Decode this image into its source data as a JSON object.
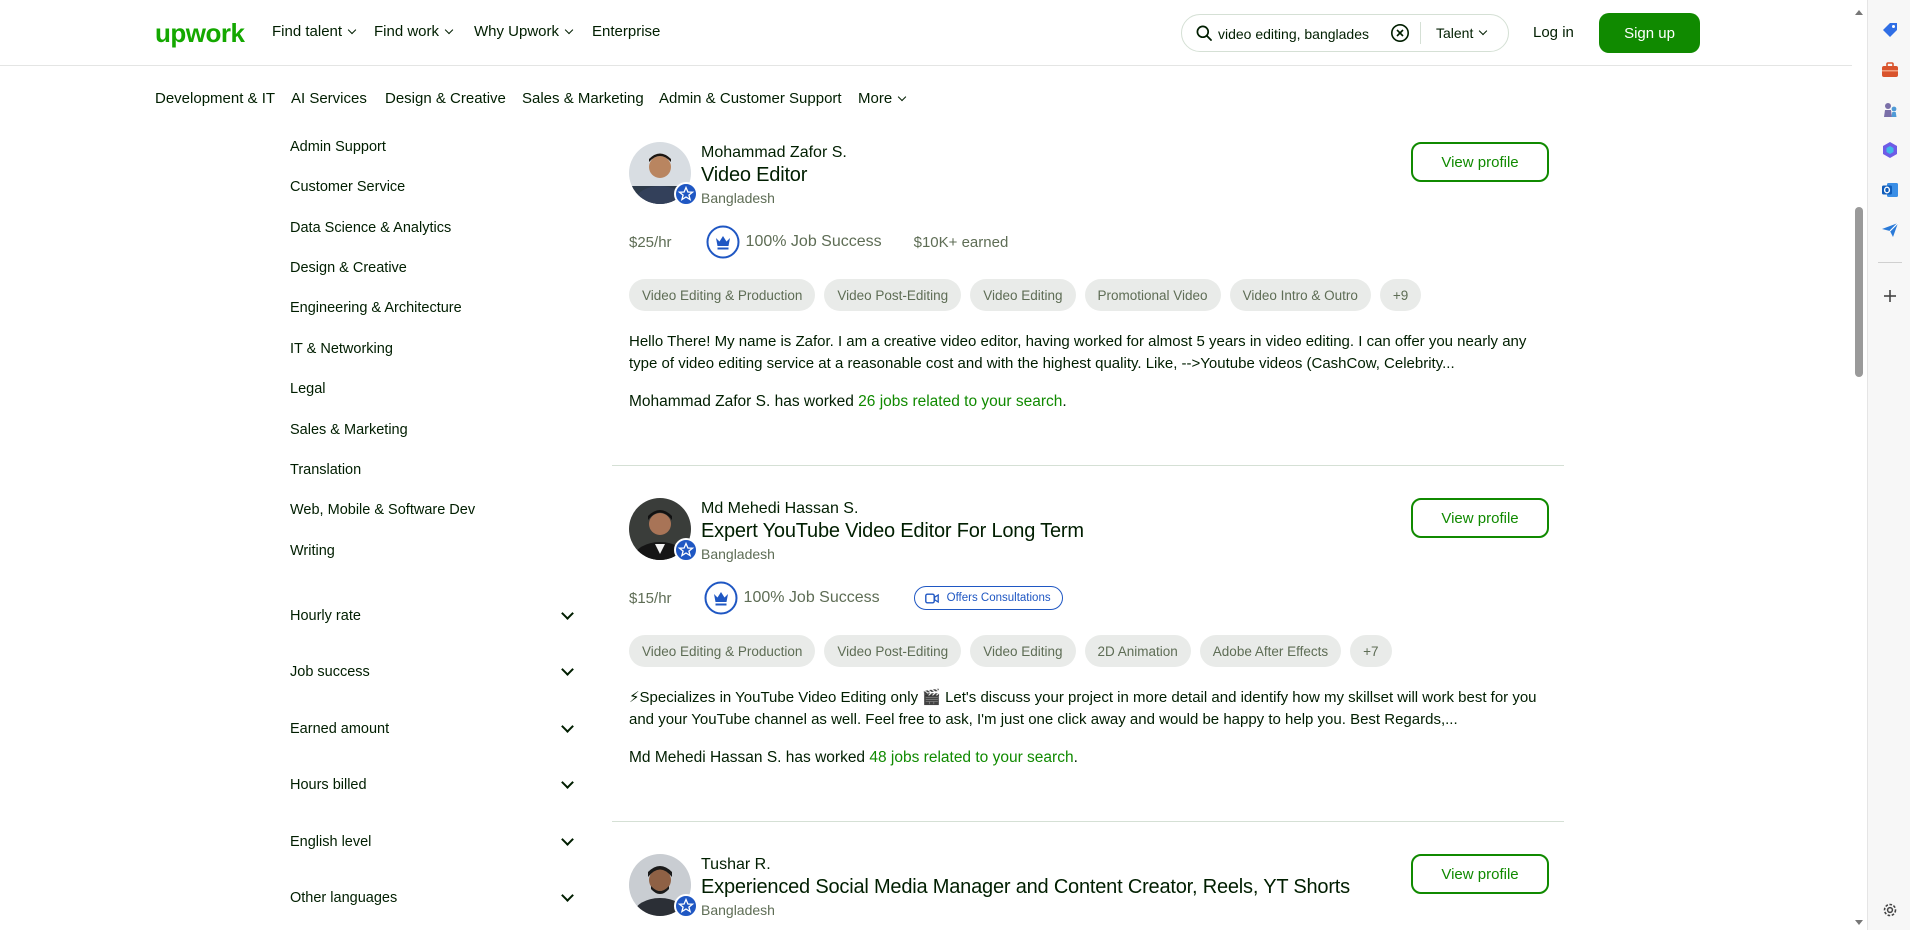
{
  "header": {
    "logo": "upwork",
    "nav": [
      "Find talent",
      "Find work",
      "Why Upwork",
      "Enterprise"
    ],
    "search": {
      "value": "video editing, banglades",
      "placeholder": "Search"
    },
    "search_type": "Talent",
    "login": "Log in",
    "signup": "Sign up"
  },
  "categories": [
    "Development & IT",
    "AI Services",
    "Design & Creative",
    "Sales & Marketing",
    "Admin & Customer Support",
    "More"
  ],
  "sidebar": {
    "categories": [
      "Admin Support",
      "Customer Service",
      "Data Science & Analytics",
      "Design & Creative",
      "Engineering & Architecture",
      "IT & Networking",
      "Legal",
      "Sales & Marketing",
      "Translation",
      "Web, Mobile & Software Dev",
      "Writing"
    ],
    "filters": [
      "Hourly rate",
      "Job success",
      "Earned amount",
      "Hours billed",
      "English level",
      "Other languages"
    ]
  },
  "freelancers": [
    {
      "name": "Mohammad Zafor S.",
      "title": "Video Editor",
      "country": "Bangladesh",
      "rate": "$25/hr",
      "job_success": "100% Job Success",
      "earned": "$10K+ earned",
      "skills": [
        "Video Editing & Production",
        "Video Post-Editing",
        "Video Editing",
        "Promotional Video",
        "Video Intro & Outro",
        "+9"
      ],
      "description": "Hello There! My name is Zafor. I am a creative video editor, having worked for almost 5 years in video editing. I can offer you nearly any type of video editing service at a reasonable cost and with the highest quality. Like, -->Youtube videos (CashCow, Celebrity...",
      "worked_prefix": "Mohammad Zafor S. has worked",
      "worked_jobs": "26 jobs related to your search",
      "view_profile": "View profile"
    },
    {
      "name": "Md Mehedi Hassan S.",
      "title": "Expert YouTube Video Editor For Long Term",
      "country": "Bangladesh",
      "rate": "$15/hr",
      "job_success": "100% Job Success",
      "consultations": "Offers Consultations",
      "skills": [
        "Video Editing & Production",
        "Video Post-Editing",
        "Video Editing",
        "2D Animation",
        "Adobe After Effects",
        "+7"
      ],
      "description": "⚡Specializes in YouTube Video Editing only 🎬 Let's discuss your project in more detail and identify how my skillset will work best for you and your YouTube channel as well. Feel free to ask, I'm just one click away and would be happy to help you. Best Regards,...",
      "worked_prefix": "Md Mehedi Hassan S. has worked",
      "worked_jobs": "48 jobs related to your search",
      "view_profile": "View profile"
    },
    {
      "name": "Tushar R.",
      "title": "Experienced Social Media Manager and Content Creator, Reels, YT Shorts",
      "country": "Bangladesh",
      "view_profile": "View profile"
    }
  ],
  "punct": {
    "period": "."
  },
  "colors": {
    "brand_green": "#14a800",
    "button_green": "#108a00",
    "consult_blue": "#1f57c3"
  }
}
